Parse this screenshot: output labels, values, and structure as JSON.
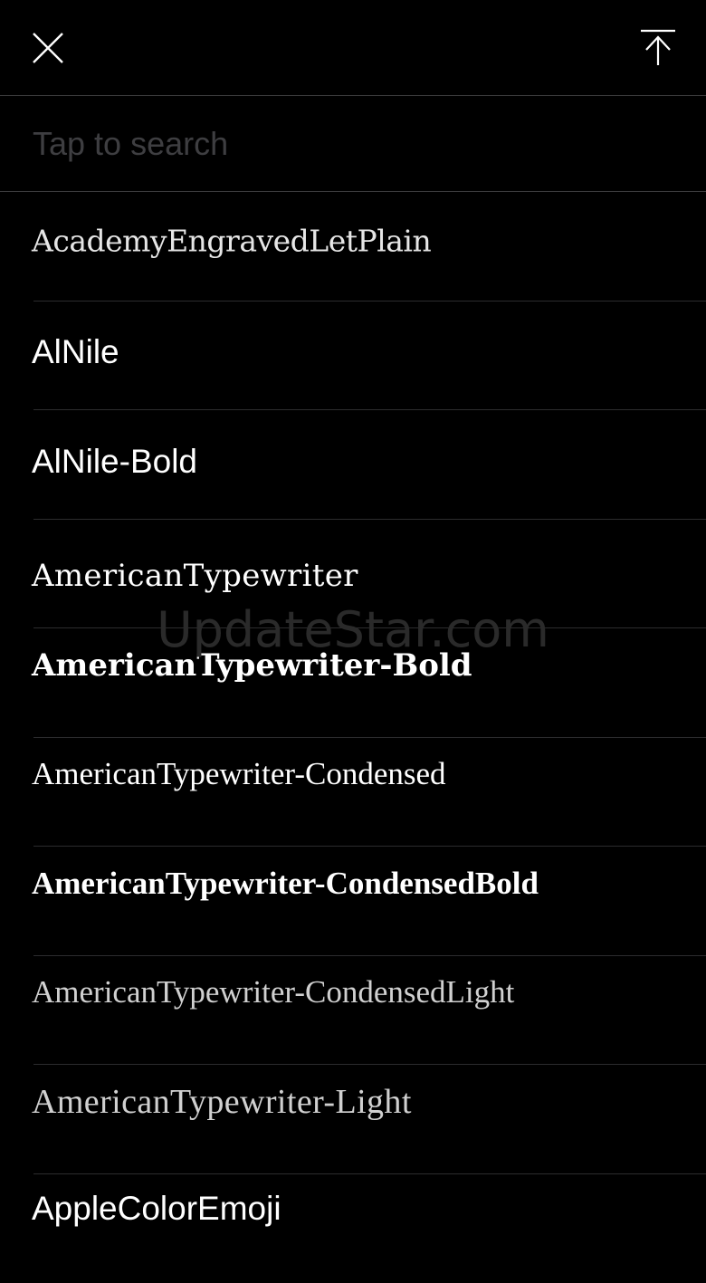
{
  "header": {
    "close_icon": "close-icon",
    "scroll_top_icon": "scroll-to-top-icon"
  },
  "search": {
    "placeholder": "Tap to search",
    "value": ""
  },
  "fonts": [
    {
      "label": "AcademyEngravedLetPlain"
    },
    {
      "label": "AlNile"
    },
    {
      "label": "AlNile-Bold"
    },
    {
      "label": "AmericanTypewriter"
    },
    {
      "label": "AmericanTypewriter-Bold"
    },
    {
      "label": "AmericanTypewriter-Condensed"
    },
    {
      "label": "AmericanTypewriter-CondensedBold"
    },
    {
      "label": "AmericanTypewriter-CondensedLight"
    },
    {
      "label": "AmericanTypewriter-Light"
    },
    {
      "label": "AppleColorEmoji"
    }
  ],
  "watermark": "UpdateStar.com",
  "colors": {
    "background": "#000000",
    "text": "#ffffff",
    "placeholder": "#3e3e41",
    "divider": "#2c2c2e"
  }
}
